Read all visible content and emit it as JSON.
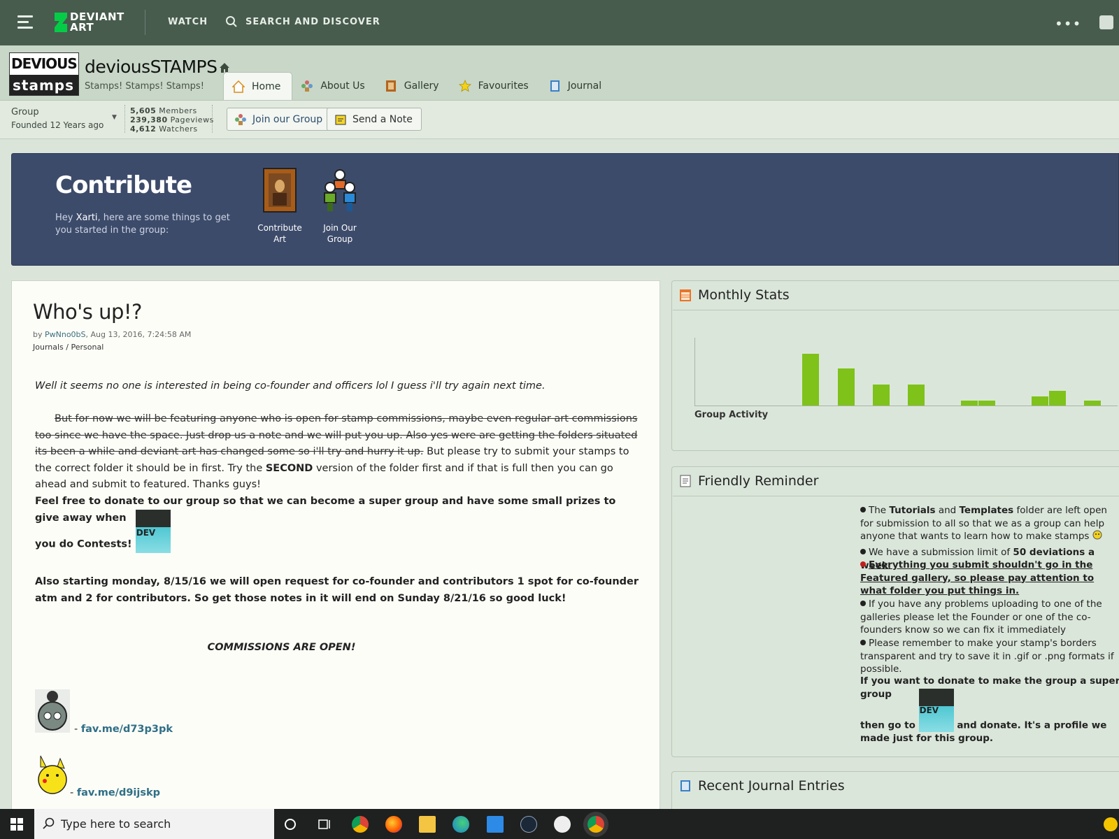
{
  "topbar": {
    "logo_line1": "DEVIANT",
    "logo_line2": "ART",
    "watch": "WATCH",
    "search": "SEARCH AND DISCOVER",
    "more": "•••"
  },
  "group": {
    "avatar_line1": "DEVIOUS",
    "avatar_line2": "stamps",
    "name": "deviousSTAMPS",
    "tagline": "Stamps! Stamps! Stamps!",
    "type": "Group",
    "founded": "Founded 12 Years ago",
    "members_count": "5,605",
    "members_label": "Members",
    "pageviews_count": "239,380",
    "pageviews_label": "Pageviews",
    "watchers_count": "4,612",
    "watchers_label": "Watchers",
    "join_button": "Join our Group",
    "note_button": "Send a Note"
  },
  "tabs": [
    {
      "label": "Home",
      "active": true
    },
    {
      "label": "About Us"
    },
    {
      "label": "Gallery"
    },
    {
      "label": "Favourites"
    },
    {
      "label": "Journal"
    }
  ],
  "contribute": {
    "title": "Contribute",
    "desc_pre": "Hey ",
    "user": "Xarti",
    "desc_post": ", here are some things to get you started in the group:",
    "items": [
      {
        "label": "Contribute Art"
      },
      {
        "label": "Join Our Group"
      }
    ]
  },
  "journal": {
    "title": "Who's up!?",
    "by_prefix": "by ",
    "author": "PwNno0bS",
    "date": ", Aug 13, 2016, 7:24:58 AM",
    "cat1": "Journals",
    "cat_sep": " / ",
    "cat2": "Personal",
    "p1": "Well it seems no one is interested in being co-founder and officers lol I guess i'll try again next time.",
    "p2_strike": "But for now we will be featuring anyone who is open for stamp commissions, maybe even regular art commissions too since we have the space. Just drop us a note and we will put you up. Also yes were are getting the folders situated its been a while and deviant art has changed some so i'll try and hurry it up.",
    "p2_a": " But please try to submit your stamps to the correct folder it should be in first. Try the ",
    "p2_bold": "SECOND",
    "p2_b": " version of the folder first and if that is full then you can go ahead and submit to featured. Thanks guys!",
    "p3": "Feel free to donate to our group so that we can become a super group and have some small prizes to give away when",
    "p3b": "you do Contests!",
    "dev_label": "DEV",
    "p4": "Also starting monday, 8/15/16 we will open request for co-founder and contributors 1 spot for co-founder atm and 2 for contributors. So get those notes in it will end on Sunday 8/21/16 so good luck!",
    "commissions": "COMMISSIONS ARE OPEN!",
    "link1_dash": " - ",
    "link1": "fav.me/d73p3pk",
    "link2_dash": " - ",
    "link2": "fav.me/d9ijskp"
  },
  "monthly_stats": {
    "title": "Monthly Stats",
    "caption": "Group Activity",
    "bar_color": "#7ec21a"
  },
  "chart_data": {
    "type": "bar",
    "title": "",
    "xlabel": "Group Activity",
    "ylabel": "",
    "values": [
      0,
      0,
      0,
      0,
      0,
      0,
      1.0,
      0,
      0.72,
      0,
      0.41,
      0,
      0.41,
      0,
      0,
      0.09,
      0.09,
      0,
      0,
      0.18,
      0.29,
      0,
      0.09
    ]
  },
  "reminder": {
    "title": "Friendly Reminder",
    "r1_a": "The ",
    "r1_b1": "Tutorials",
    "r1_c": " and ",
    "r1_b2": "Templates",
    "r1_d": " folder are left open for submission to all so that we as a group can help anyone that wants to learn how to make stamps",
    "r2_a": "We have a submission limit of ",
    "r2_b": "50 deviations a week",
    "r2_c": ".",
    "r3": "Everything you submit shouldn't go in the Featured gallery, so please pay attention to what folder you put things in.",
    "r4": "If you have any problems uploading to one of the galleries please let the Founder or one of the co-founders know so we can fix it immediately",
    "r5": "Please remember to make your stamp's borders transparent and try to save it in .gif or .png formats if possible.",
    "donate_a": "If you want to donate to make the group a super group",
    "donate_b": "then go to",
    "donate_c": "and donate. It's a profile we made just for this group.",
    "dev_label": "DEV"
  },
  "recent": {
    "title": "Recent Journal Entries"
  },
  "taskbar": {
    "search_placeholder": "Type here to search"
  }
}
